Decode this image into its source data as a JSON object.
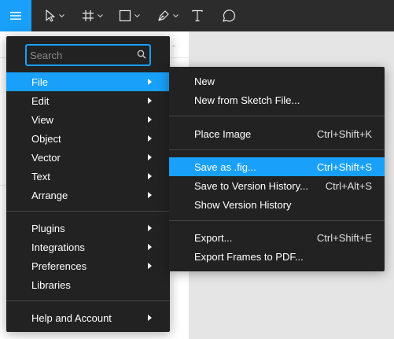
{
  "toolbar": {
    "tools": [
      {
        "name": "main-menu",
        "icon": "hamburger-icon"
      },
      {
        "name": "move",
        "icon": "cursor-arrow-icon"
      },
      {
        "name": "frame",
        "icon": "frame-hash-icon"
      },
      {
        "name": "shape",
        "icon": "rectangle-icon"
      },
      {
        "name": "pen",
        "icon": "pen-icon"
      },
      {
        "name": "text",
        "icon": "text-t-icon"
      },
      {
        "name": "comment",
        "icon": "comment-bubble-icon"
      }
    ],
    "accent": "#18a0fb",
    "background": "#2c2c2c"
  },
  "main_menu": {
    "search": {
      "placeholder": "Search",
      "value": ""
    },
    "items": [
      {
        "label": "File",
        "submenu": true,
        "active": true
      },
      {
        "label": "Edit",
        "submenu": true
      },
      {
        "label": "View",
        "submenu": true
      },
      {
        "label": "Object",
        "submenu": true
      },
      {
        "label": "Vector",
        "submenu": true
      },
      {
        "label": "Text",
        "submenu": true
      },
      {
        "label": "Arrange",
        "submenu": true
      },
      {
        "label": "Plugins",
        "submenu": true
      },
      {
        "label": "Integrations",
        "submenu": true
      },
      {
        "label": "Preferences",
        "submenu": true
      },
      {
        "label": "Libraries",
        "submenu": false
      },
      {
        "label": "Help and Account",
        "submenu": true
      }
    ]
  },
  "file_menu": {
    "items": [
      {
        "label": "New",
        "shortcut": ""
      },
      {
        "label": "New from Sketch File...",
        "shortcut": ""
      },
      {
        "label": "Place Image",
        "shortcut": "Ctrl+Shift+K"
      },
      {
        "label": "Save as .fig...",
        "shortcut": "Ctrl+Shift+S",
        "active": true
      },
      {
        "label": "Save to Version History...",
        "shortcut": "Ctrl+Alt+S"
      },
      {
        "label": "Show Version History",
        "shortcut": ""
      },
      {
        "label": "Export...",
        "shortcut": "Ctrl+Shift+E"
      },
      {
        "label": "Export Frames to PDF...",
        "shortcut": ""
      }
    ]
  }
}
